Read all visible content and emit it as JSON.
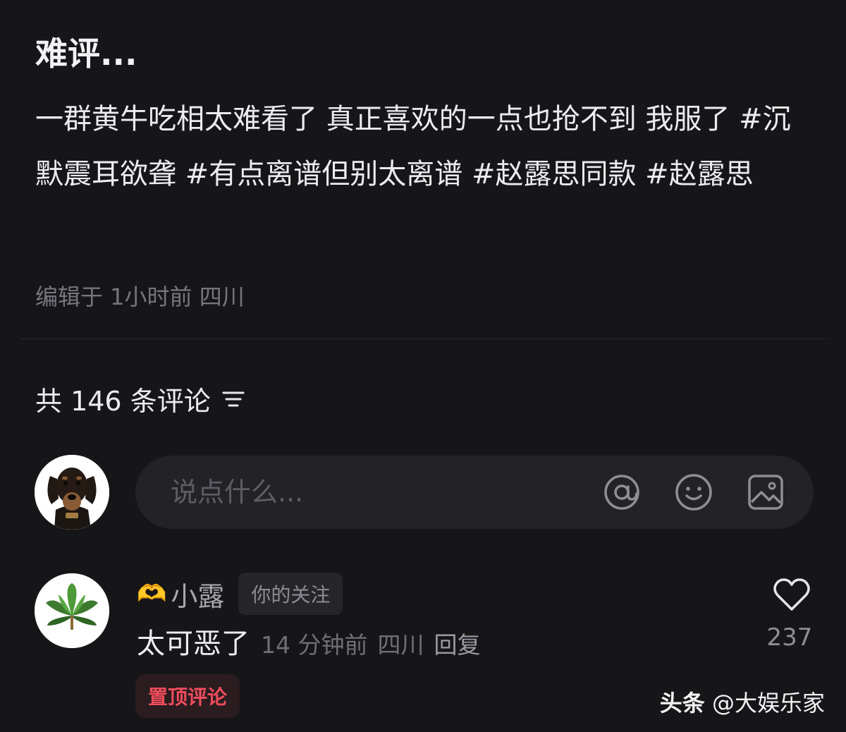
{
  "post": {
    "title": "难评...",
    "body": "一群黄牛吃相太难看了 真正喜欢的一点也抢不到 我服了 #沉默震耳欲聋 #有点离谱但别太离谱 #赵露思同款 #赵露思",
    "meta": "编辑于 1小时前 四川"
  },
  "comments_header": {
    "label": "共 146 条评论",
    "sort_icon": "filter-lines-icon"
  },
  "input": {
    "placeholder": "说点什么...",
    "icons": [
      "at-icon",
      "emoji-icon",
      "image-icon"
    ]
  },
  "comment": {
    "name_emoji": "🫶",
    "name": "小露",
    "badge": "你的关注",
    "text": "太可恶了",
    "time": "14 分钟前",
    "location": "四川",
    "reply": "回复",
    "likes": "237",
    "pin_label": "置顶评论"
  },
  "watermark": {
    "brand": "头条",
    "account": "@大娱乐家"
  },
  "colors": {
    "background": "#161619",
    "pin_red": "#f04c5c",
    "muted_text": "#76767d"
  }
}
